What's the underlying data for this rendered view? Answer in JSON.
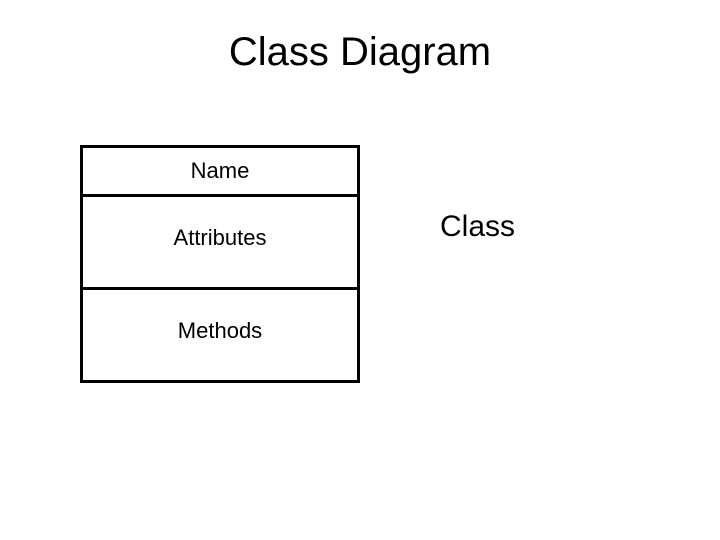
{
  "title": "Class Diagram",
  "box": {
    "name": "Name",
    "attributes": "Attributes",
    "methods": "Methods"
  },
  "side_label": "Class"
}
